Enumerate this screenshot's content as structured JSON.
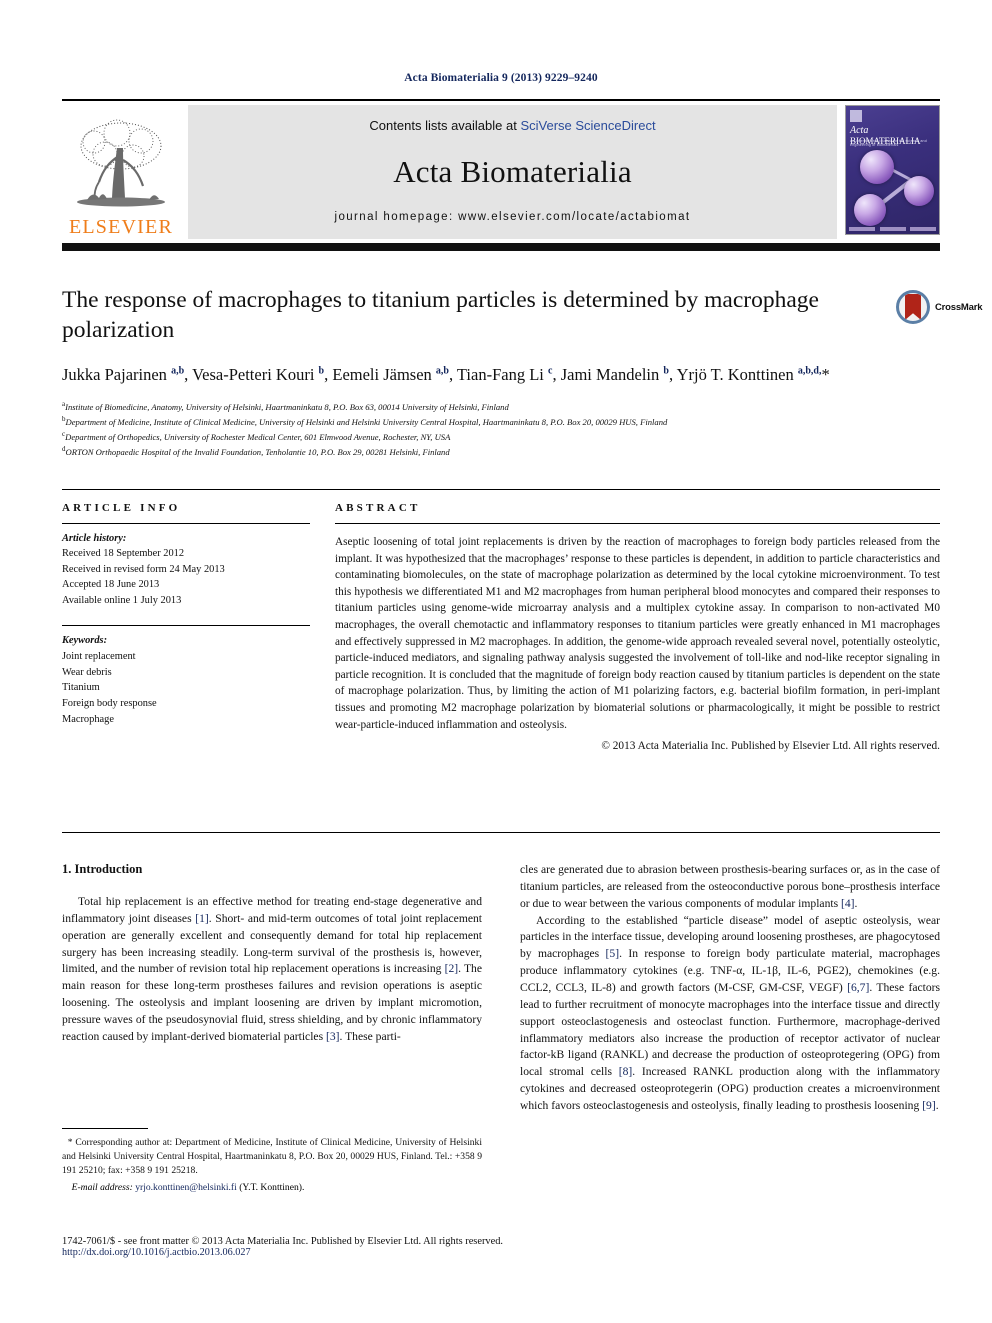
{
  "running_head": "Acta Biomaterialia 9 (2013) 9229–9240",
  "masthead": {
    "contents_prefix": "Contents lists available at ",
    "sciencedirect": "SciVerse ScienceDirect",
    "journal_name": "Acta Biomaterialia",
    "homepage": "journal homepage: www.elsevier.com/locate/actabiomat",
    "publisher_logo_text": "ELSEVIER",
    "cover": {
      "title_italic": "Acta",
      "title_rest": "BIOMATERIALIA",
      "subtitle": "An international journal for the science and engineering of biomaterials"
    }
  },
  "crossmark": {
    "label": "CrossMark"
  },
  "article": {
    "title": "The response of macrophages to titanium particles is determined by macrophage polarization",
    "authors_html": "Jukka Pajarinen <sup>a,b</sup>, Vesa-Petteri Kouri <sup>b</sup>, Eemeli Jämsen <sup>a,b</sup>, Tian-Fang Li <sup>c</sup>, Jami Mandelin <sup>b</sup>, Yrjö T. Konttinen <sup>a,b,d,</sup>*",
    "affiliations": [
      {
        "marker": "a",
        "text": "Institute of Biomedicine, Anatomy, University of Helsinki, Haartmaninkatu 8, P.O. Box 63, 00014 University of Helsinki, Finland"
      },
      {
        "marker": "b",
        "text": "Department of Medicine, Institute of Clinical Medicine, University of Helsinki and Helsinki University Central Hospital, Haartmaninkatu 8, P.O. Box 20, 00029 HUS, Finland"
      },
      {
        "marker": "c",
        "text": "Department of Orthopedics, University of Rochester Medical Center, 601 Elmwood Avenue, Rochester, NY, USA"
      },
      {
        "marker": "d",
        "text": "ORTON Orthopaedic Hospital of the Invalid Foundation, Tenholantie 10, P.O. Box 29, 00281 Helsinki, Finland"
      }
    ]
  },
  "article_info": {
    "heading": "ARTICLE INFO",
    "history_label": "Article history:",
    "history": [
      "Received 18 September 2012",
      "Received in revised form 24 May 2013",
      "Accepted 18 June 2013",
      "Available online 1 July 2013"
    ],
    "keywords_label": "Keywords:",
    "keywords": [
      "Joint replacement",
      "Wear debris",
      "Titanium",
      "Foreign body response",
      "Macrophage"
    ]
  },
  "abstract": {
    "heading": "ABSTRACT",
    "text": "Aseptic loosening of total joint replacements is driven by the reaction of macrophages to foreign body particles released from the implant. It was hypothesized that the macrophages’ response to these particles is dependent, in addition to particle characteristics and contaminating biomolecules, on the state of macrophage polarization as determined by the local cytokine microenvironment. To test this hypothesis we differentiated M1 and M2 macrophages from human peripheral blood monocytes and compared their responses to titanium particles using genome-wide microarray analysis and a multiplex cytokine assay. In comparison to non-activated M0 macrophages, the overall chemotactic and inflammatory responses to titanium particles were greatly enhanced in M1 macrophages and effectively suppressed in M2 macrophages. In addition, the genome-wide approach revealed several novel, potentially osteolytic, particle-induced mediators, and signaling pathway analysis suggested the involvement of toll-like and nod-like receptor signaling in particle recognition. It is concluded that the magnitude of foreign body reaction caused by titanium particles is dependent on the state of macrophage polarization. Thus, by limiting the action of M1 polarizing factors, e.g. bacterial biofilm formation, in peri-implant tissues and promoting M2 macrophage polarization by biomaterial solutions or pharmacologically, it might be possible to restrict wear-particle-induced inflammation and osteolysis.",
    "copyright": "© 2013 Acta Materialia Inc. Published by Elsevier Ltd. All rights reserved."
  },
  "introduction": {
    "section_title": "1. Introduction",
    "para1_a": "Total hip replacement is an effective method for treating end-stage degenerative and inflammatory joint diseases ",
    "ref1": "[1]",
    "para1_b": ". Short- and mid-term outcomes of total joint replacement operation are generally excellent and consequently demand for total hip replacement surgery has been increasing steadily. Long-term survival of the prosthesis is, however, limited, and the number of revision total hip replacement operations is increasing ",
    "ref2": "[2]",
    "para1_c": ". The main reason for these long-term prostheses failures and revision operations is aseptic loosening. The osteolysis and implant loosening are driven by implant micromotion, pressure waves of the pseudosynovial fluid, stress shielding, and by chronic inflammatory reaction caused by implant-derived biomaterial particles ",
    "ref3": "[3]",
    "para1_d": ". These parti-",
    "para2_a": "cles are generated due to abrasion between prosthesis-bearing surfaces or, as in the case of titanium particles, are released from the osteoconductive porous bone–prosthesis interface or due to wear between the various components of modular implants ",
    "ref4": "[4]",
    "para2_b": ".",
    "para3_a": "According to the established “particle disease” model of aseptic osteolysis, wear particles in the interface tissue, developing around loosening prostheses, are phagocytosed by macrophages ",
    "ref5": "[5]",
    "para3_b": ". In response to foreign body particulate material, macrophages produce inflammatory cytokines (e.g. TNF-α, IL-1β, IL-6, PGE2), chemokines (e.g. CCL2, CCL3, IL-8) and growth factors (M-CSF, GM-CSF, VEGF) ",
    "ref67": "[6,7]",
    "para3_c": ". These factors lead to further recruitment of monocyte macrophages into the interface tissue and directly support osteoclastogenesis and osteoclast function. Furthermore, macrophage-derived inflammatory mediators also increase the production of receptor activator of nuclear factor-kB ligand (RANKL) and decrease the production of osteoprotegering (OPG) from local stromal cells ",
    "ref8": "[8]",
    "para3_d": ". Increased RANKL production along with the inflammatory cytokines and decreased osteoprotegerin (OPG) production creates a microenvironment which favors osteoclastogenesis and osteolysis, finally leading to prosthesis loosening ",
    "ref9": "[9]",
    "para3_e": "."
  },
  "footnote": {
    "star": "*",
    "corresponding": "Corresponding author at: Department of Medicine, Institute of Clinical Medicine, University of Helsinki and Helsinki University Central Hospital, Haartmaninkatu 8, P.O. Box 20, 00029 HUS, Finland. Tel.: +358 9 191 25210; fax: +358 9 191 25218.",
    "email_label": "E-mail address:",
    "email": "yrjo.konttinen@helsinki.fi",
    "email_owner": "(Y.T. Konttinen)."
  },
  "bottom_matter": {
    "issn_line": "1742-7061/$ - see front matter © 2013 Acta Materialia Inc. Published by Elsevier Ltd. All rights reserved.",
    "doi": "http://dx.doi.org/10.1016/j.actbio.2013.06.027"
  },
  "colors": {
    "link_blue": "#13265c",
    "sciencedirect_blue": "#2b4c9b",
    "elsevier_orange": "#ef7d1a",
    "crossmark_red": "#b02418"
  }
}
